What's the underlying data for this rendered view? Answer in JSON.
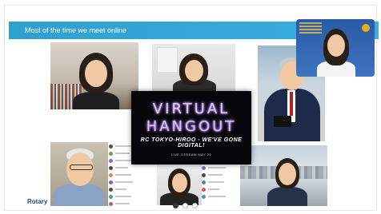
{
  "slide": {
    "title": "Most of the time we meet online",
    "logo_text": "Rotary"
  },
  "hangout": {
    "line1": "VIRTUAL",
    "line2": "HANGOUT",
    "subtitle": "RC TOKYO-HIROO - WE'VE GONE DIGITAL!",
    "live": "LIVE STREAM MAY 20"
  },
  "pagination": {
    "total": 3,
    "active": 0
  },
  "colors": {
    "banner": "#2f9fcf",
    "rotary_blue": "#1b4e91"
  }
}
